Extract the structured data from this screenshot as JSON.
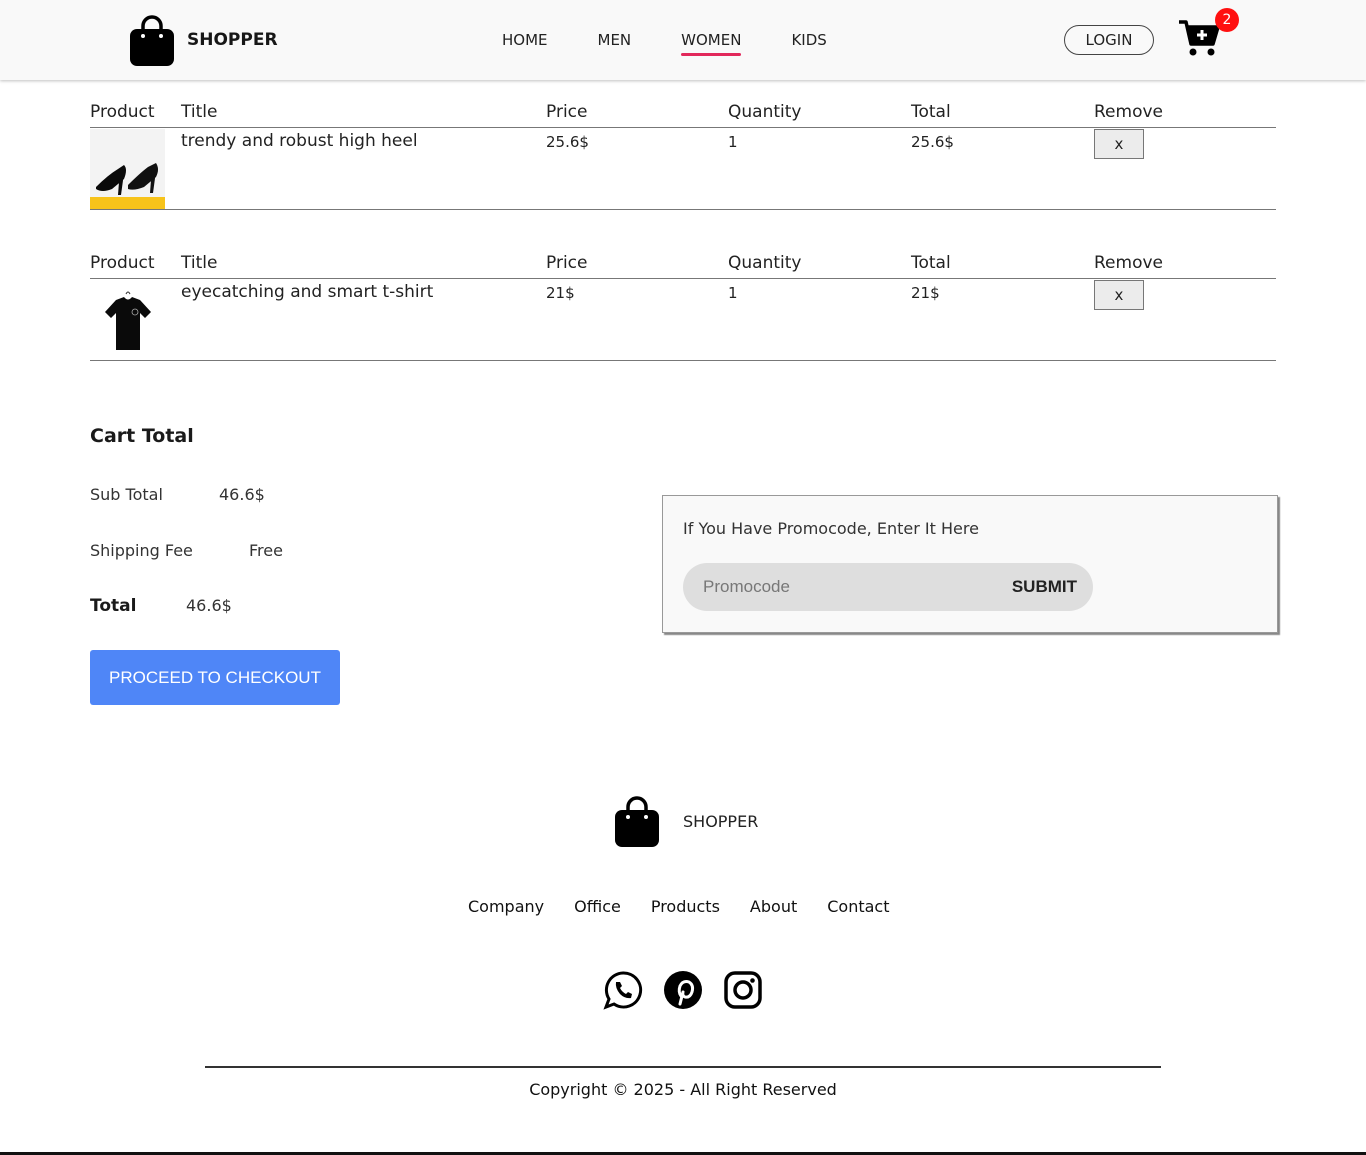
{
  "header": {
    "brand": "SHOPPER",
    "nav": [
      {
        "label": "HOME",
        "active": false
      },
      {
        "label": "MEN",
        "active": false
      },
      {
        "label": "WOMEN",
        "active": true
      },
      {
        "label": "KIDS",
        "active": false
      }
    ],
    "login_label": "LOGIN",
    "cart_count": "2",
    "accent_color": "#e2285b"
  },
  "cart": {
    "columns": [
      "Product",
      "Title",
      "Price",
      "Quantity",
      "Total",
      "Remove"
    ],
    "items": [
      {
        "title": "trendy and robust high heel",
        "price": "25.6$",
        "quantity": "1",
        "total": "25.6$",
        "remove_label": "x",
        "image": "black-high-heels-image"
      },
      {
        "title": "eyecatching and smart t-shirt",
        "price": "21$",
        "quantity": "1",
        "total": "21$",
        "remove_label": "x",
        "image": "black-t-shirt-image"
      }
    ]
  },
  "summary": {
    "heading": "Cart Total",
    "subtotal_label": "Sub Total",
    "subtotal_value": "46.6$",
    "shipping_label": "Shipping Fee",
    "shipping_value": "Free",
    "total_label": "Total",
    "total_value": "46.6$",
    "checkout_label": "PROCEED TO CHECKOUT",
    "checkout_color": "#4f86f7"
  },
  "promo": {
    "prompt": "If You Have Promocode, Enter It Here",
    "placeholder": "Promocode",
    "submit_label": "SUBMIT"
  },
  "footer": {
    "brand": "SHOPPER",
    "links": [
      "Company",
      "Office",
      "Products",
      "About",
      "Contact"
    ],
    "socials": [
      "whatsapp-icon",
      "pinterest-icon",
      "instagram-icon"
    ],
    "copyright": "Copyright © 2025 - All Right Reserved"
  }
}
